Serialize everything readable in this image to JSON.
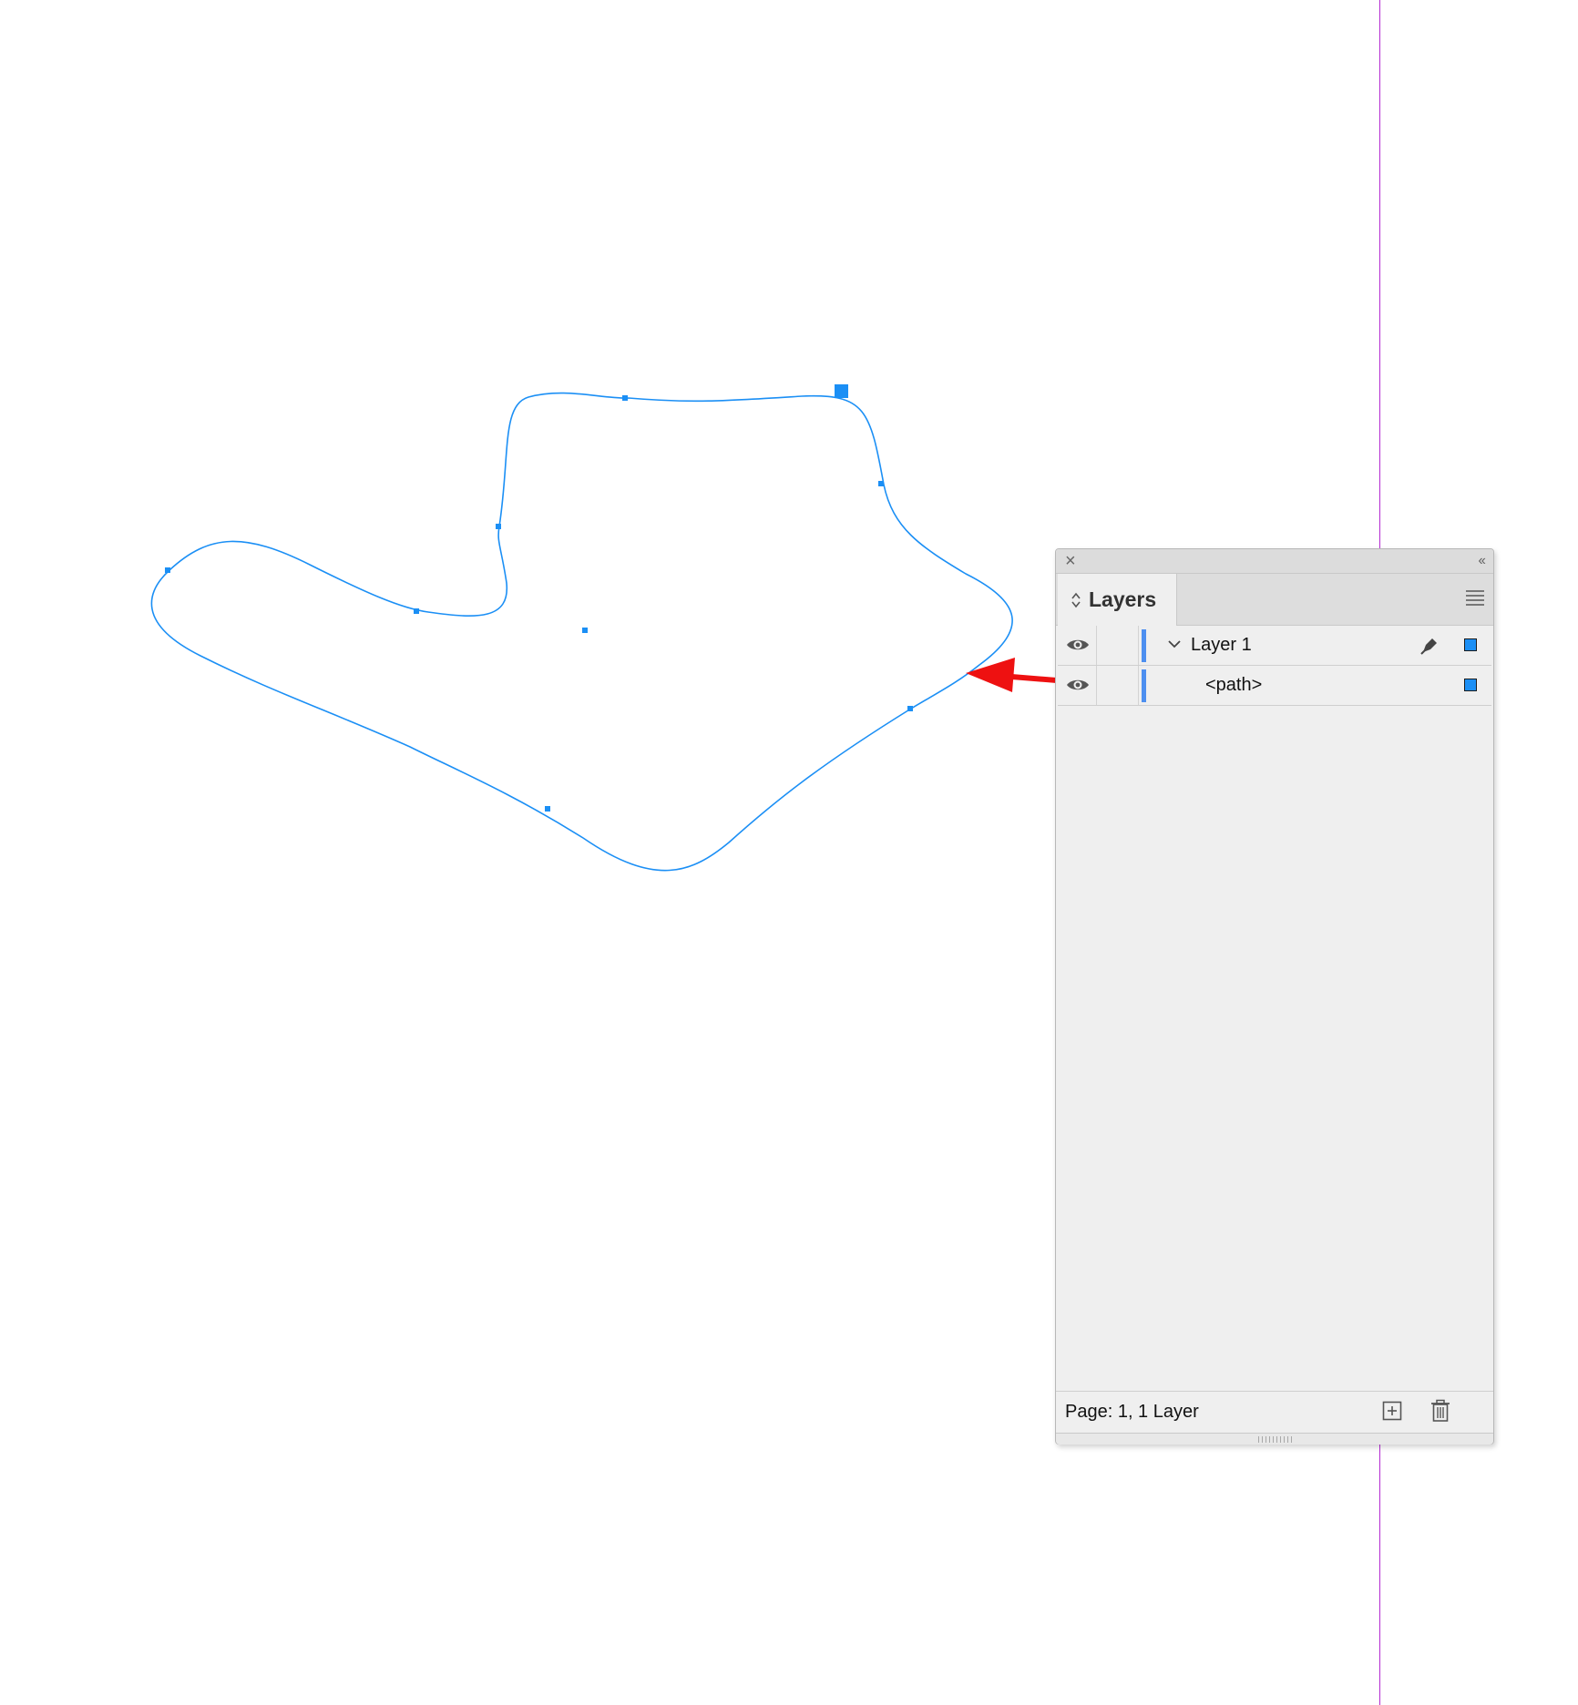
{
  "panel": {
    "tab_title": "Layers",
    "rows": [
      {
        "name": "Layer 1",
        "expanded": true,
        "visible": true,
        "layer_color": "#4d8ff0"
      },
      {
        "name": "<path>",
        "visible": true,
        "layer_color": "#4d8ff0"
      }
    ],
    "status": "Page: 1, 1 Layer"
  },
  "colors": {
    "path_stroke": "#1b8ff5",
    "guide": "#b42ad2",
    "annotation_arrow": "#ee1111"
  },
  "icons": {
    "close": "close-icon",
    "collapse": "double-chevron-left-icon",
    "tab": "up-down-arrows-icon",
    "menu": "hamburger-menu-icon",
    "visibility": "eye-icon",
    "expand": "chevron-down-icon",
    "edit": "pen-icon",
    "new_layer": "new-layer-icon",
    "delete": "trash-icon"
  }
}
